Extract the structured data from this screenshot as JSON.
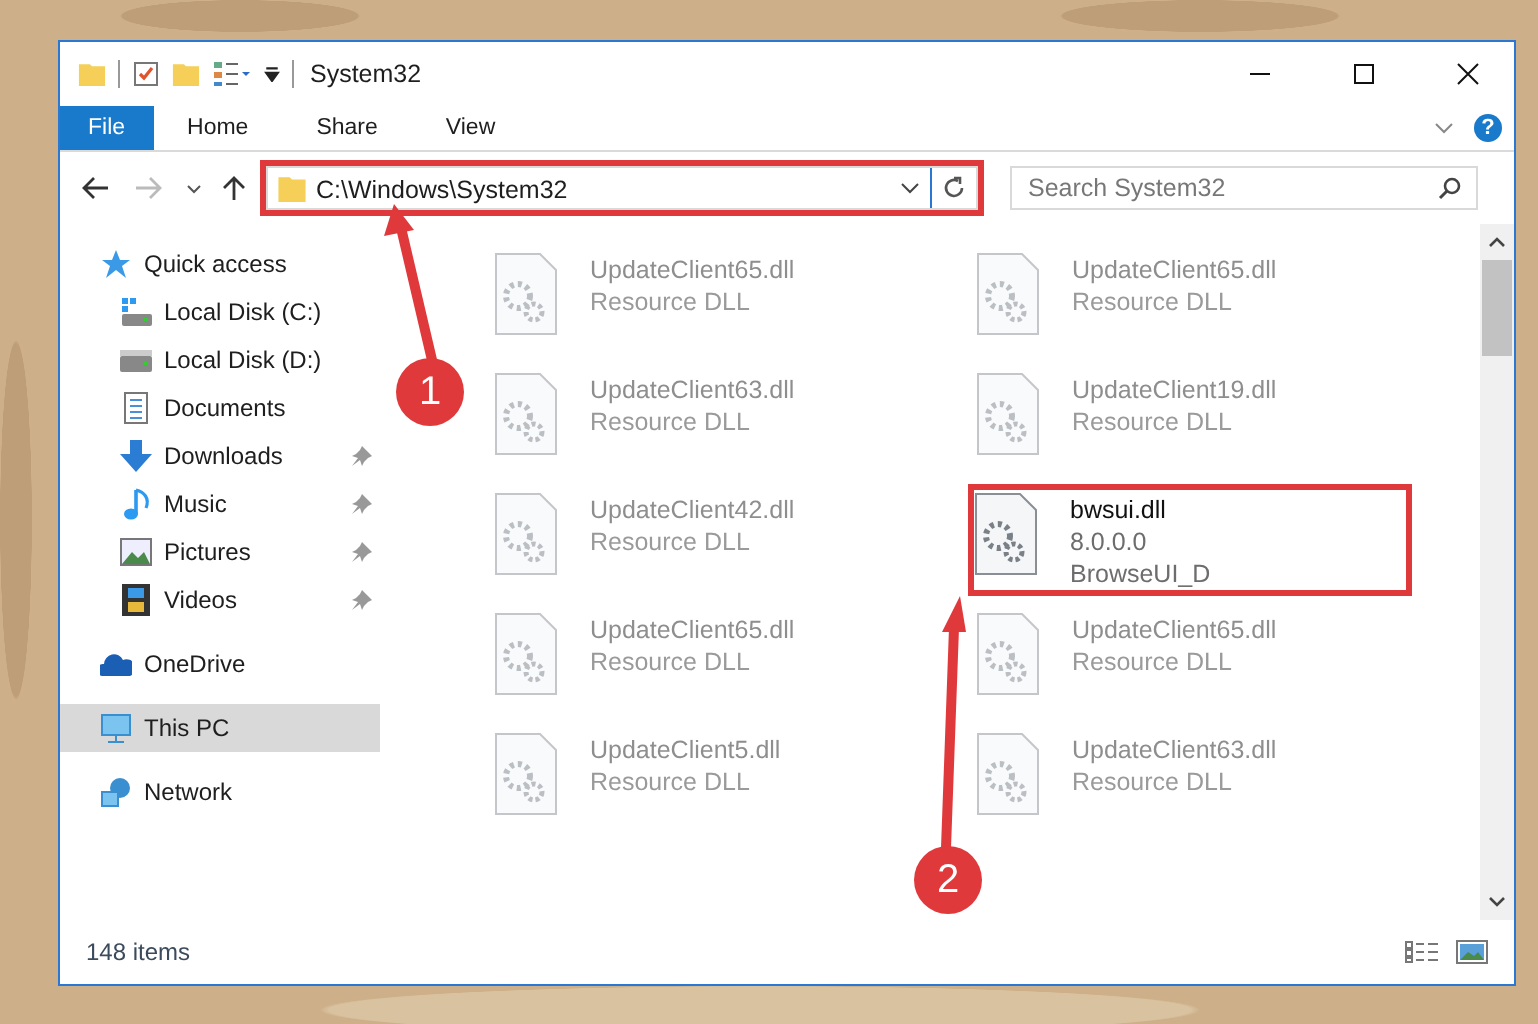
{
  "window": {
    "title": "System32",
    "help_label": "?"
  },
  "ribbon": {
    "tabs": [
      {
        "label": "File",
        "kind": "file"
      },
      {
        "label": "Home",
        "kind": "tab"
      },
      {
        "label": "Share",
        "kind": "tab"
      },
      {
        "label": "View",
        "kind": "tab"
      }
    ]
  },
  "address_bar": {
    "path": "C:\\Windows\\System32",
    "highlighted": true
  },
  "search": {
    "placeholder": "Search System32"
  },
  "sidebar": {
    "items": [
      {
        "label": "Quick access",
        "selected": false,
        "children": [
          {
            "label": "Local Disk (C:)",
            "pinned": false,
            "selected": false
          },
          {
            "label": "Local Disk (D:)",
            "pinned": false,
            "selected": false
          },
          {
            "label": "Documents",
            "pinned": false,
            "selected": false
          },
          {
            "label": "Downloads",
            "pinned": true,
            "selected": false
          },
          {
            "label": "Music",
            "pinned": true,
            "selected": false
          },
          {
            "label": "Pictures",
            "pinned": true,
            "selected": false
          },
          {
            "label": "Videos",
            "pinned": true,
            "selected": false
          }
        ]
      },
      {
        "label": "OneDrive",
        "selected": false
      },
      {
        "label": "This PC",
        "selected": true
      },
      {
        "label": "Network",
        "selected": false
      }
    ]
  },
  "files": [
    {
      "name": "UpdateClient65.dll",
      "details": [
        "Resource DLL"
      ],
      "dimmed": true,
      "highlighted": false
    },
    {
      "name": "UpdateClient65.dll",
      "details": [
        "Resource DLL"
      ],
      "dimmed": true,
      "highlighted": false
    },
    {
      "name": "UpdateClient63.dll",
      "details": [
        "Resource DLL"
      ],
      "dimmed": true,
      "highlighted": false
    },
    {
      "name": "UpdateClient19.dll",
      "details": [
        "Resource DLL"
      ],
      "dimmed": true,
      "highlighted": false
    },
    {
      "name": "UpdateClient42.dll",
      "details": [
        "Resource DLL"
      ],
      "dimmed": true,
      "highlighted": false
    },
    {
      "name": "bwsui.dll",
      "details": [
        "8.0.0.0",
        "BrowseUI_D"
      ],
      "dimmed": false,
      "highlighted": true
    },
    {
      "name": "UpdateClient65.dll",
      "details": [
        "Resource DLL"
      ],
      "dimmed": true,
      "highlighted": false
    },
    {
      "name": "UpdateClient65.dll",
      "details": [
        "Resource DLL"
      ],
      "dimmed": true,
      "highlighted": false
    },
    {
      "name": "UpdateClient5.dll",
      "details": [
        "Resource DLL"
      ],
      "dimmed": true,
      "highlighted": false
    },
    {
      "name": "UpdateClient63.dll",
      "details": [
        "Resource DLL"
      ],
      "dimmed": true,
      "highlighted": false
    }
  ],
  "status_bar": {
    "item_count": "148 items"
  },
  "markers": [
    {
      "label": "1"
    },
    {
      "label": "2"
    }
  ]
}
